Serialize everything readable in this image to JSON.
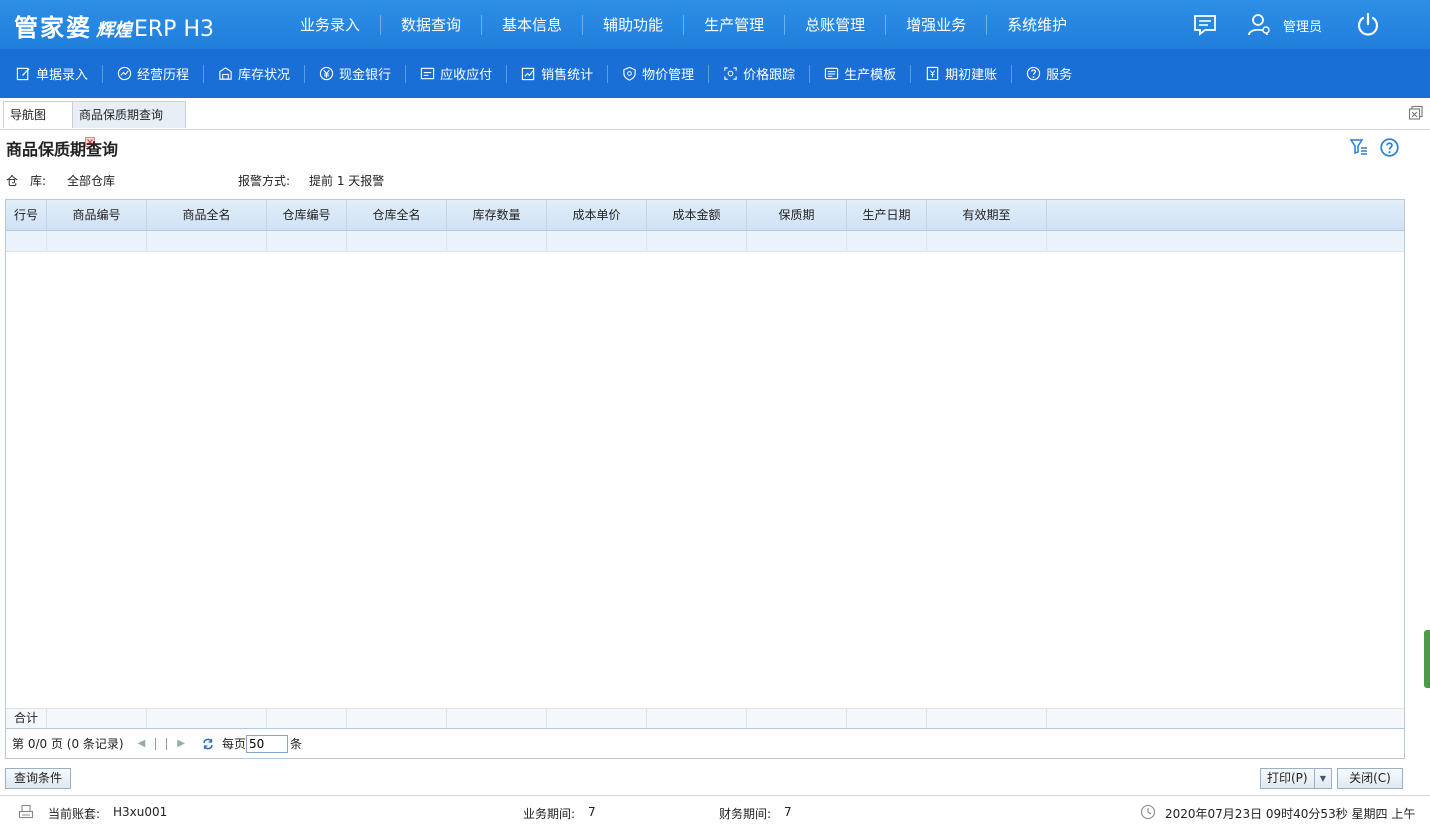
{
  "brand": {
    "name": "管家婆",
    "sub": "辉煌",
    "product": "ERP H3"
  },
  "main_nav": [
    "业务录入",
    "数据查询",
    "基本信息",
    "辅助功能",
    "生产管理",
    "总账管理",
    "增强业务",
    "系统维护"
  ],
  "user": {
    "name": "管理员"
  },
  "toolbar": [
    {
      "label": "单据录入",
      "icon": "edit-icon"
    },
    {
      "label": "经营历程",
      "icon": "trend-icon"
    },
    {
      "label": "库存状况",
      "icon": "warehouse-icon"
    },
    {
      "label": "现金银行",
      "icon": "currency-icon"
    },
    {
      "label": "应收应付",
      "icon": "receivable-icon"
    },
    {
      "label": "销售统计",
      "icon": "stats-icon"
    },
    {
      "label": "物价管理",
      "icon": "shield-icon"
    },
    {
      "label": "价格跟踪",
      "icon": "track-icon"
    },
    {
      "label": "生产模板",
      "icon": "template-icon"
    },
    {
      "label": "期初建账",
      "icon": "ledger-icon"
    },
    {
      "label": "服务",
      "icon": "help-icon"
    }
  ],
  "tabs": [
    {
      "label": "导航图",
      "active": false
    },
    {
      "label": "商品保质期查询",
      "active": true
    }
  ],
  "page": {
    "title": "商品保质期查询",
    "filters": {
      "warehouse_label": "仓　库:",
      "warehouse_value": "全部仓库",
      "alarm_label": "报警方式:",
      "alarm_value": "提前 1 天报警"
    }
  },
  "grid": {
    "columns": [
      "行号",
      "商品编号",
      "商品全名",
      "仓库编号",
      "仓库全名",
      "库存数量",
      "成本单价",
      "成本金额",
      "保质期",
      "生产日期",
      "有效期至"
    ],
    "rows": [],
    "footer_label": "合计"
  },
  "pager": {
    "info": "第 0/0 页 (0 条记录)",
    "per_page_label": "每页",
    "per_page_value": "50",
    "unit": "条"
  },
  "buttons": {
    "query": "查询条件",
    "print": "打印(P)",
    "close": "关闭(C)"
  },
  "status": {
    "account_label": "当前账套:",
    "account_value": "H3xu001",
    "biz_period_label": "业务期间:",
    "biz_period_value": "7",
    "fin_period_label": "财务期间:",
    "fin_period_value": "7",
    "datetime": "2020年07月23日 09时40分53秒 星期四 上午"
  },
  "colors": {
    "topbar": "#1f7edb",
    "toolbar": "#1a6fd6",
    "grid_header": "#d6e6f6",
    "accent_green": "#4d9a4a"
  }
}
